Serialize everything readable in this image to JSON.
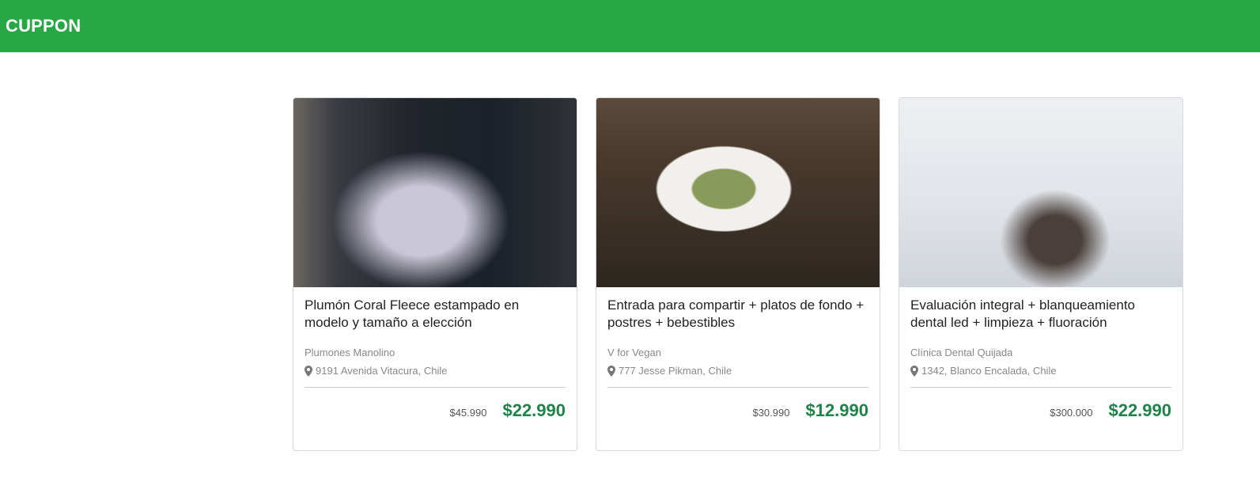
{
  "header": {
    "brand": "CUPPON",
    "color": "#28a745"
  },
  "deals": [
    {
      "title": "Plumón Coral Fleece estampado en modelo y tamaño a elección",
      "merchant": "Plumones Manolino",
      "location": "9191 Avenida Vitacura, Chile",
      "old_price": "$45.990",
      "price": "$22.990",
      "image": "bedroom-photo"
    },
    {
      "title": "Entrada para compartir + platos de fondo + postres + bebestibles",
      "merchant": "V for Vegan",
      "location": "777 Jesse Pikman, Chile",
      "old_price": "$30.990",
      "price": "$12.990",
      "image": "vegan-salad-photo"
    },
    {
      "title": "Evaluación integral + blanqueamiento dental led + limpieza + fluoración",
      "merchant": "Clínica Dental Quijada",
      "location": "1342, Blanco Encalada, Chile",
      "old_price": "$300.000",
      "price": "$22.990",
      "image": "dental-chair-photo"
    }
  ],
  "price_color": "#1e8449"
}
